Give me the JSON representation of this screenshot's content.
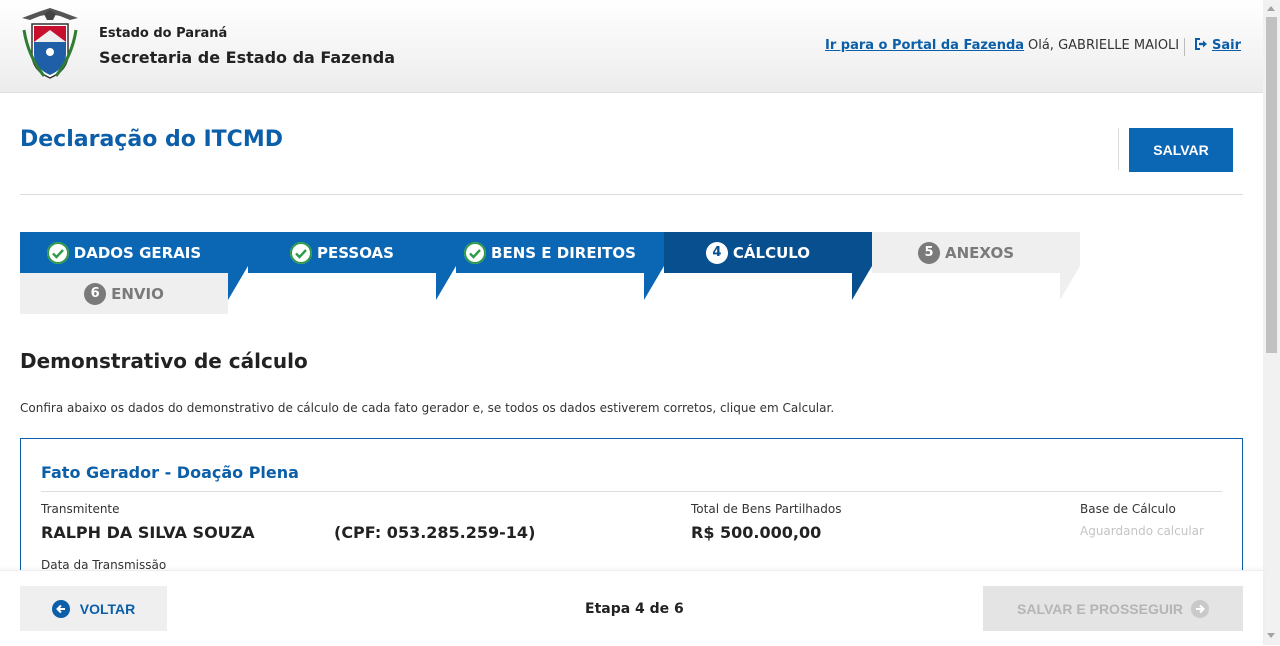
{
  "header": {
    "state": "Estado do Paraná",
    "department": "Secretaria de Estado da Fazenda",
    "portal_link": "Ir para o Portal da Fazenda",
    "greeting": "Olá, GABRIELLE MAIOLI",
    "logout_label": "Sair",
    "crest_icon": "parana-coat-of-arms",
    "logout_icon": "sign-out-icon"
  },
  "page": {
    "title": "Declaração do ITCMD",
    "save_label": "SALVAR"
  },
  "steps": [
    {
      "label": "DADOS GERAIS",
      "status": "done",
      "icon": "check-circle-icon"
    },
    {
      "label": "PESSOAS",
      "status": "done",
      "icon": "check-circle-icon"
    },
    {
      "label": "BENS E DIREITOS",
      "status": "done",
      "icon": "check-circle-icon"
    },
    {
      "label": "CÁLCULO",
      "status": "current",
      "number": "4"
    },
    {
      "label": "ANEXOS",
      "status": "pending",
      "number": "5"
    },
    {
      "label": "ENVIO",
      "status": "pending",
      "number": "6"
    }
  ],
  "section": {
    "title": "Demonstrativo de cálculo",
    "intro": "Confira abaixo os dados do demonstrativo de cálculo de cada fato gerador e, se todos os dados estiverem corretos, clique em Calcular."
  },
  "card": {
    "title": "Fato Gerador - Doação Plena",
    "transmitter_label": "Transmitente",
    "transmitter_name": "RALPH DA SILVA SOUZA",
    "transmitter_cpf": "(CPF: 053.285.259-14)",
    "total_label": "Total de Bens Partilhados",
    "total_value": "R$ 500.000,00",
    "base_label": "Base de Cálculo",
    "base_value": "Aguardando calcular",
    "date_label": "Data da Transmissão"
  },
  "footer": {
    "back_label": "VOLTAR",
    "stage_text": "Etapa 4 de 6",
    "next_label": "SALVAR E PROSSEGUIR"
  },
  "colors": {
    "primary": "#0b66b4",
    "primary_dark": "#074f8f",
    "link": "#0b5ea8",
    "pending_bg": "#efefef",
    "pending_text": "#7a7a7a"
  }
}
